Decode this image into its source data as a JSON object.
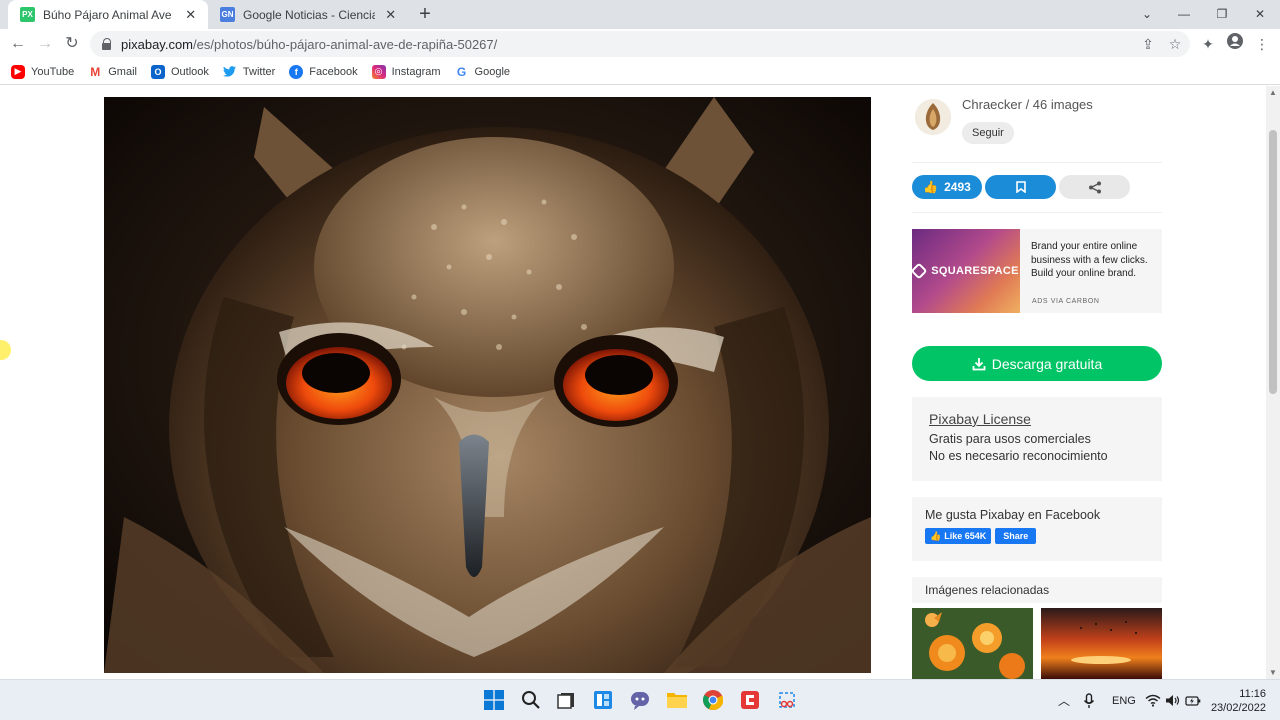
{
  "browser": {
    "tabs": [
      {
        "title": "Búho Pájaro Animal Ave De - Fot",
        "favicon": "PX",
        "favicon_color": "#2ec66d",
        "active": true
      },
      {
        "title": "Google Noticias - Ciencia y tecnol",
        "favicon": "GN",
        "favicon_color": "#4a7fe0",
        "active": false
      }
    ],
    "url_host": "pixabay.com",
    "url_path": "/es/photos/búho-pájaro-animal-ave-de-rapiña-50267/",
    "bookmarks": [
      {
        "label": "YouTube",
        "icon": "youtube-icon",
        "color": "#ff0000"
      },
      {
        "label": "Gmail",
        "icon": "gmail-icon",
        "color": "#ea4335"
      },
      {
        "label": "Outlook",
        "icon": "outlook-icon",
        "color": "#0a64c9"
      },
      {
        "label": "Twitter",
        "icon": "twitter-icon",
        "color": "#1d9bf0"
      },
      {
        "label": "Facebook",
        "icon": "facebook-icon",
        "color": "#1877f2"
      },
      {
        "label": "Instagram",
        "icon": "instagram-icon",
        "color": "#c13584"
      },
      {
        "label": "Google",
        "icon": "google-icon",
        "color": "#4285f4"
      }
    ]
  },
  "sidebar": {
    "author": "Chraecker / 46 images",
    "follow_label": "Seguir",
    "likes": "2493",
    "ad": {
      "brand": "SQUARESPACE",
      "text": "Brand your entire online business with a few clicks. Build your online brand.",
      "via": "ADS VIA CARBON"
    },
    "download_label": "Descarga gratuita",
    "license": {
      "title": "Pixabay License",
      "line1": "Gratis para usos comerciales",
      "line2": "No es necesario reconocimiento"
    },
    "facebook": {
      "title": "Me gusta Pixabay en Facebook",
      "like_label": "Like 654K",
      "share_label": "Share"
    },
    "related_title": "Imágenes relacionadas"
  },
  "taskbar": {
    "language": "ENG",
    "time": "11:16",
    "date": "23/02/2022"
  },
  "colors": {
    "download": "#00c465",
    "like": "#1a8cd8",
    "facebook": "#1877f2"
  }
}
